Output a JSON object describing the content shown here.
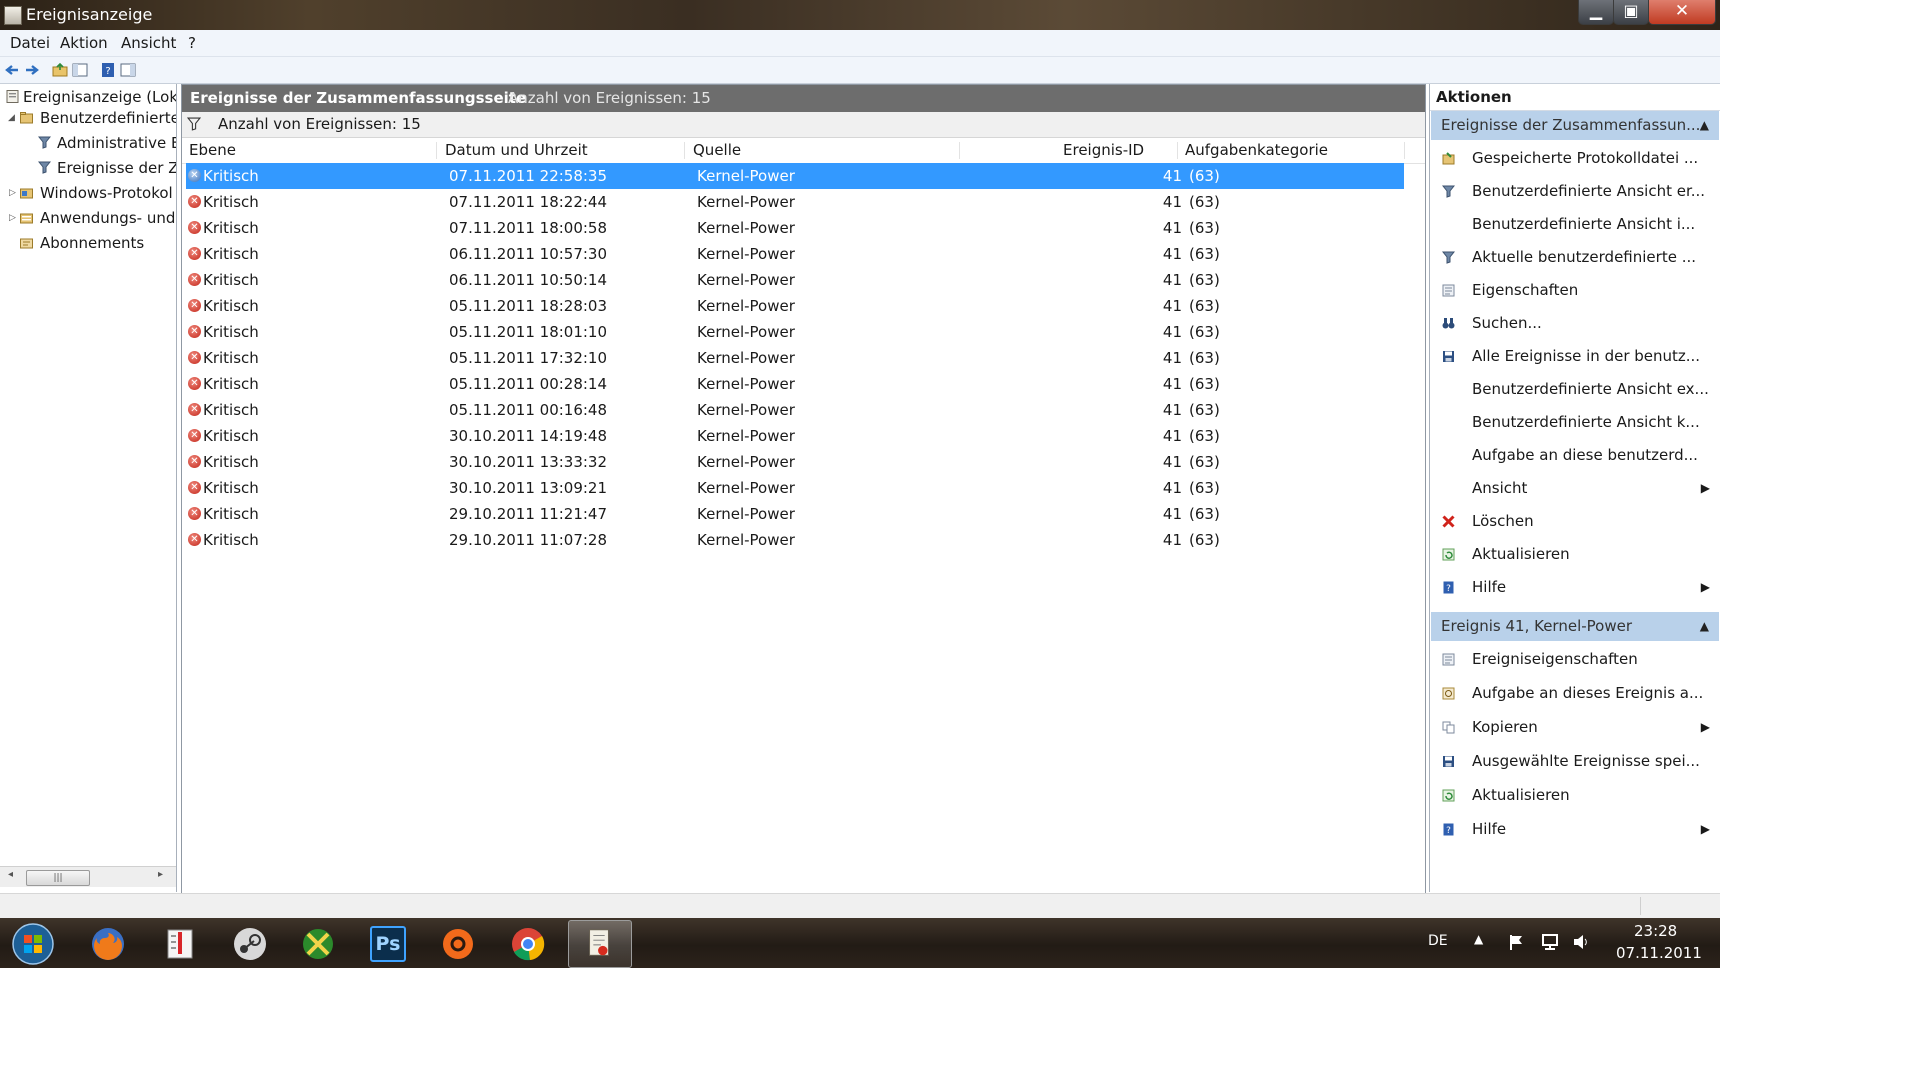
{
  "window": {
    "title": "Ereignisanzeige"
  },
  "menu": [
    "Datei",
    "Aktion",
    "Ansicht",
    "?"
  ],
  "tree": [
    {
      "label": "Ereignisanzeige (Loka",
      "level": 0,
      "arrow": ""
    },
    {
      "label": "Benutzerdefinierte .",
      "level": 1,
      "arrow": "◢"
    },
    {
      "label": "Administrative E",
      "level": 2,
      "arrow": ""
    },
    {
      "label": "Ereignisse der Zu",
      "level": 2,
      "arrow": ""
    },
    {
      "label": "Windows-Protokol",
      "level": 1,
      "arrow": "▷"
    },
    {
      "label": "Anwendungs- und",
      "level": 1,
      "arrow": "▷"
    },
    {
      "label": "Abonnements",
      "level": 1,
      "arrow": ""
    }
  ],
  "center": {
    "title": "Ereignisse der Zusammenfassungsseite",
    "count_header": "Anzahl von Ereignissen: 15",
    "filter_text": "Anzahl von Ereignissen: 15",
    "columns": [
      "Ebene",
      "Datum und Uhrzeit",
      "Quelle",
      "Ereignis-ID",
      "Aufgabenkategorie"
    ],
    "rows": [
      [
        "Kritisch",
        "07.11.2011 22:58:35",
        "Kernel-Power",
        "41",
        "(63)"
      ],
      [
        "Kritisch",
        "07.11.2011 18:22:44",
        "Kernel-Power",
        "41",
        "(63)"
      ],
      [
        "Kritisch",
        "07.11.2011 18:00:58",
        "Kernel-Power",
        "41",
        "(63)"
      ],
      [
        "Kritisch",
        "06.11.2011 10:57:30",
        "Kernel-Power",
        "41",
        "(63)"
      ],
      [
        "Kritisch",
        "06.11.2011 10:50:14",
        "Kernel-Power",
        "41",
        "(63)"
      ],
      [
        "Kritisch",
        "05.11.2011 18:28:03",
        "Kernel-Power",
        "41",
        "(63)"
      ],
      [
        "Kritisch",
        "05.11.2011 18:01:10",
        "Kernel-Power",
        "41",
        "(63)"
      ],
      [
        "Kritisch",
        "05.11.2011 17:32:10",
        "Kernel-Power",
        "41",
        "(63)"
      ],
      [
        "Kritisch",
        "05.11.2011 00:28:14",
        "Kernel-Power",
        "41",
        "(63)"
      ],
      [
        "Kritisch",
        "05.11.2011 00:16:48",
        "Kernel-Power",
        "41",
        "(63)"
      ],
      [
        "Kritisch",
        "30.10.2011 14:19:48",
        "Kernel-Power",
        "41",
        "(63)"
      ],
      [
        "Kritisch",
        "30.10.2011 13:33:32",
        "Kernel-Power",
        "41",
        "(63)"
      ],
      [
        "Kritisch",
        "30.10.2011 13:09:21",
        "Kernel-Power",
        "41",
        "(63)"
      ],
      [
        "Kritisch",
        "29.10.2011 11:21:47",
        "Kernel-Power",
        "41",
        "(63)"
      ],
      [
        "Kritisch",
        "29.10.2011 11:07:28",
        "Kernel-Power",
        "41",
        "(63)"
      ]
    ],
    "selected_row": 0
  },
  "actions": {
    "title": "Aktionen",
    "sections": [
      {
        "header": "Ereignisse der Zusammenfassun...",
        "items": [
          {
            "label": "Gespeicherte Protokolldatei ...",
            "icon": "open-log-icon",
            "submenu": false
          },
          {
            "label": "Benutzerdefinierte Ansicht er...",
            "icon": "filter-icon",
            "submenu": false
          },
          {
            "label": "Benutzerdefinierte Ansicht i...",
            "icon": "",
            "submenu": false
          },
          {
            "label": "Aktuelle benutzerdefinierte ...",
            "icon": "filter-icon",
            "submenu": false
          },
          {
            "label": "Eigenschaften",
            "icon": "properties-icon",
            "submenu": false
          },
          {
            "label": "Suchen...",
            "icon": "binoculars-icon",
            "submenu": false
          },
          {
            "label": "Alle Ereignisse in der benutz...",
            "icon": "save-icon",
            "submenu": false
          },
          {
            "label": "Benutzerdefinierte Ansicht ex...",
            "icon": "",
            "submenu": false
          },
          {
            "label": "Benutzerdefinierte Ansicht k...",
            "icon": "",
            "submenu": false
          },
          {
            "label": "Aufgabe an diese benutzerd...",
            "icon": "",
            "submenu": false
          },
          {
            "label": "Ansicht",
            "icon": "",
            "submenu": true
          },
          {
            "label": "Löschen",
            "icon": "delete-icon",
            "submenu": false
          },
          {
            "label": "Aktualisieren",
            "icon": "refresh-icon",
            "submenu": false
          },
          {
            "label": "Hilfe",
            "icon": "help-icon",
            "submenu": true
          }
        ]
      },
      {
        "header": "Ereignis 41, Kernel-Power",
        "items": [
          {
            "label": "Ereigniseigenschaften",
            "icon": "properties-icon",
            "submenu": false
          },
          {
            "label": "Aufgabe an dieses Ereignis a...",
            "icon": "task-icon",
            "submenu": false
          },
          {
            "label": "Kopieren",
            "icon": "copy-icon",
            "submenu": true
          },
          {
            "label": "Ausgewählte Ereignisse spei...",
            "icon": "save-icon",
            "submenu": false
          },
          {
            "label": "Aktualisieren",
            "icon": "refresh-icon",
            "submenu": false
          },
          {
            "label": "Hilfe",
            "icon": "help-icon",
            "submenu": true
          }
        ]
      }
    ]
  },
  "taskbar": {
    "apps": [
      "start-orb-icon",
      "firefox-icon",
      "thermometer-app-icon",
      "steam-icon",
      "xbox-app-icon",
      "photoshop-icon",
      "origin-icon",
      "chrome-icon",
      "event-viewer-taskbar-icon"
    ],
    "photoshop_label": "Ps",
    "language": "DE",
    "time": "23:28",
    "date": "07.11.2011"
  },
  "colors": {
    "selection": "#3399ff",
    "error": "#c3261a",
    "section_header": "#b9d1ea",
    "panel_header": "#6d6d6d"
  }
}
